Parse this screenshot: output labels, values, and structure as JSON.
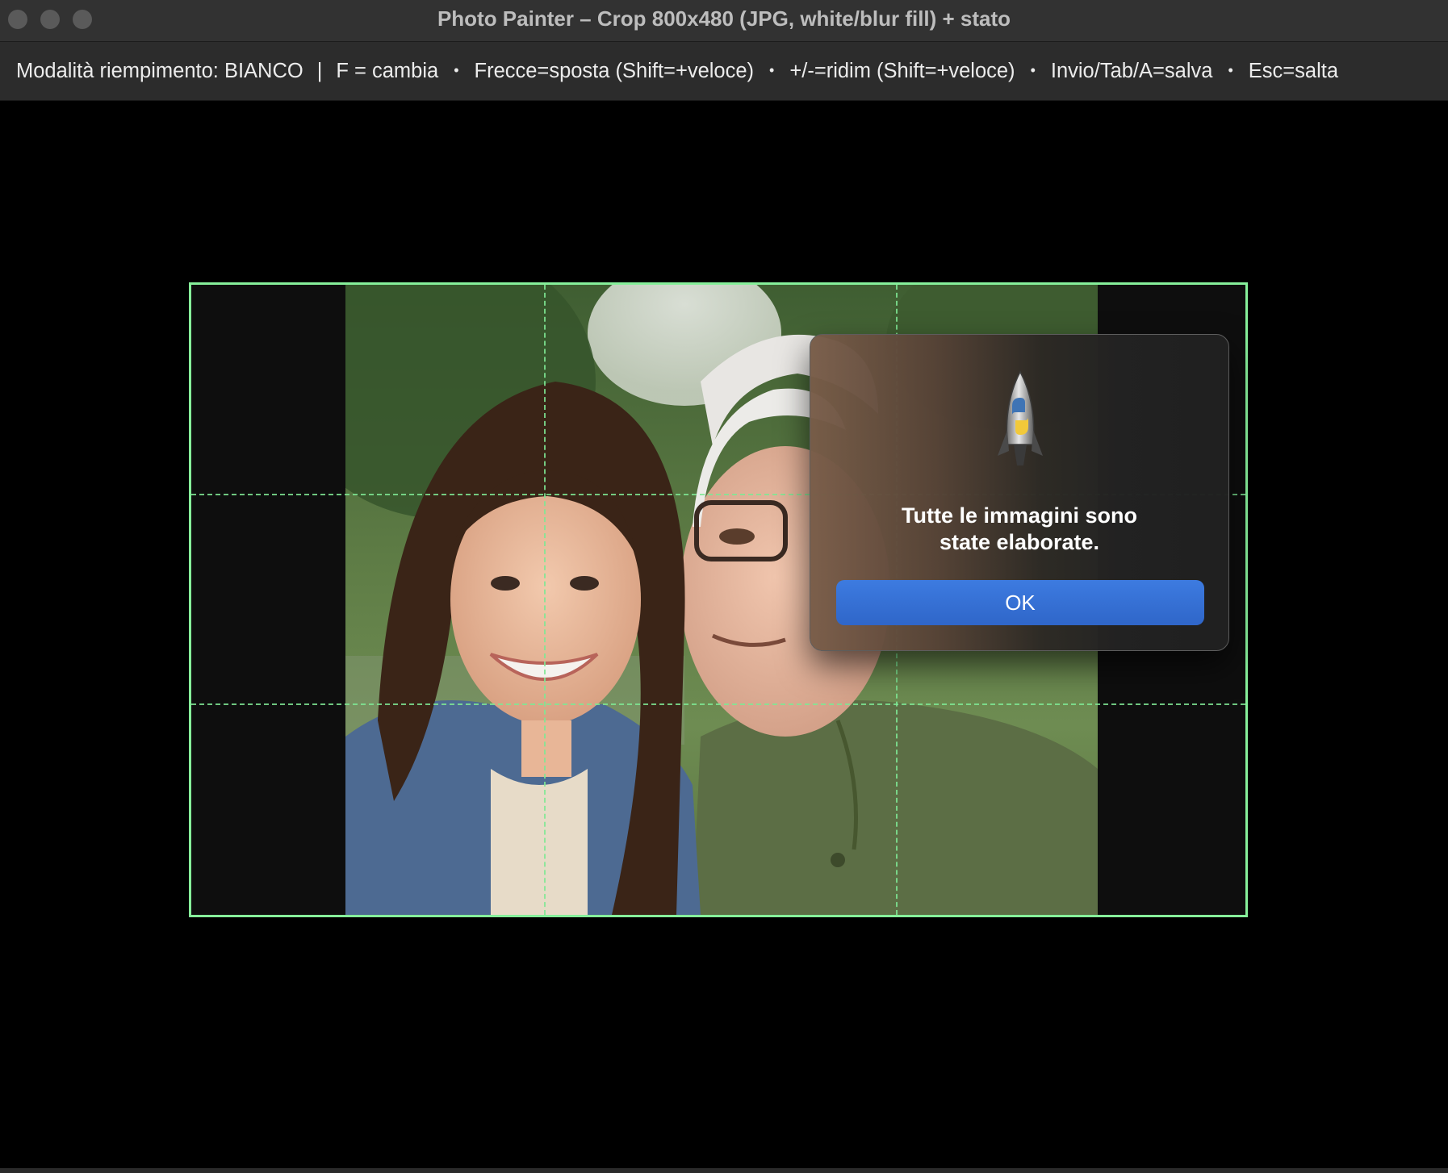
{
  "window": {
    "title": "Photo Painter – Crop 800x480 (JPG, white/blur fill) + stato"
  },
  "statusbar": {
    "fill_mode": "Modalità riempimento: BIANCO",
    "sep_bar": "|",
    "sep_dot": "•",
    "hint_toggle": "F = cambia",
    "hint_move": "Frecce=sposta (Shift=+veloce)",
    "hint_resize": "+/-=ridim (Shift=+veloce)",
    "hint_save": "Invio/Tab/A=salva",
    "hint_skip": "Esc=salta"
  },
  "dialog": {
    "icon": "python-launcher-rocket-icon",
    "message_line1": "Tutte le immagini sono",
    "message_line2": "state elaborate.",
    "ok_label": "OK"
  },
  "colors": {
    "crop_border": "#86ef9a",
    "guide": "#7fe894",
    "ok_button": "#3470d6",
    "letterbox_fill": "#0e0e0e"
  }
}
